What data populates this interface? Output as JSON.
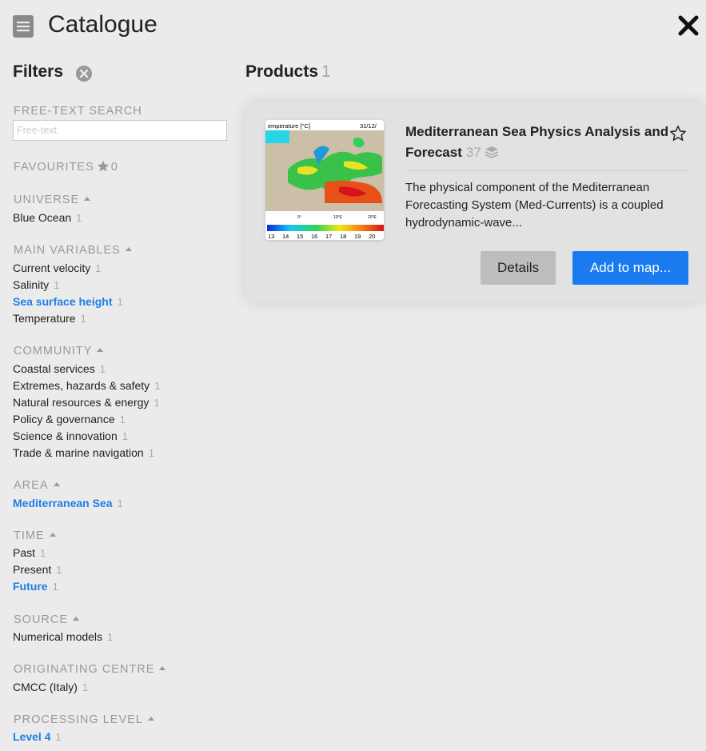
{
  "header": {
    "title": "Catalogue",
    "close_icon": "close-icon",
    "catalogue_icon": "catalogue-book-icon"
  },
  "filters": {
    "title": "Filters",
    "clear_icon": "clear-filters-icon",
    "search": {
      "label": "FREE-TEXT SEARCH",
      "placeholder": "Free-text",
      "value": ""
    },
    "favourites": {
      "label": "FAVOURITES",
      "count": "0",
      "icon": "star-icon"
    },
    "sections": [
      {
        "label": "UNIVERSE",
        "items": [
          {
            "label": "Blue Ocean",
            "count": "1",
            "active": false
          }
        ]
      },
      {
        "label": "MAIN VARIABLES",
        "items": [
          {
            "label": "Current velocity",
            "count": "1",
            "active": false
          },
          {
            "label": "Salinity",
            "count": "1",
            "active": false
          },
          {
            "label": "Sea surface height",
            "count": "1",
            "active": true
          },
          {
            "label": "Temperature",
            "count": "1",
            "active": false
          }
        ]
      },
      {
        "label": "COMMUNITY",
        "items": [
          {
            "label": "Coastal services",
            "count": "1",
            "active": false
          },
          {
            "label": "Extremes, hazards & safety",
            "count": "1",
            "active": false
          },
          {
            "label": "Natural resources & energy",
            "count": "1",
            "active": false
          },
          {
            "label": "Policy & governance",
            "count": "1",
            "active": false
          },
          {
            "label": "Science & innovation",
            "count": "1",
            "active": false
          },
          {
            "label": "Trade & marine navigation",
            "count": "1",
            "active": false
          }
        ]
      },
      {
        "label": "AREA",
        "items": [
          {
            "label": "Mediterranean Sea",
            "count": "1",
            "active": true
          }
        ]
      },
      {
        "label": "TIME",
        "items": [
          {
            "label": "Past",
            "count": "1",
            "active": false
          },
          {
            "label": "Present",
            "count": "1",
            "active": false
          },
          {
            "label": "Future",
            "count": "1",
            "active": true
          }
        ]
      },
      {
        "label": "SOURCE",
        "items": [
          {
            "label": "Numerical models",
            "count": "1",
            "active": false
          }
        ]
      },
      {
        "label": "ORIGINATING CENTRE",
        "items": [
          {
            "label": "CMCC (Italy)",
            "count": "1",
            "active": false
          }
        ]
      },
      {
        "label": "PROCESSING LEVEL",
        "items": [
          {
            "label": "Level 4",
            "count": "1",
            "active": true
          }
        ]
      }
    ]
  },
  "products": {
    "title": "Products",
    "count": "1",
    "items": [
      {
        "title": "Mediterranean Sea Physics Analysis and Forecast",
        "layers_count": "37",
        "description": "The physical component of the Mediterranean Forecasting System (Med-Currents) is a coupled hydrodynamic-wave...",
        "details_label": "Details",
        "add_label": "Add to map...",
        "thumbnail": {
          "header_left": "emperature [°C]",
          "header_right": "31/12/",
          "axis_ticks": [
            "0°",
            "10°E",
            "20°E"
          ],
          "scale_ticks": [
            "13",
            "14",
            "15",
            "16",
            "17",
            "18",
            "19",
            "20"
          ]
        },
        "favourite_icon": "star-outline-icon",
        "layers_icon": "layers-icon"
      }
    ]
  },
  "colors": {
    "background": "#ebebeb",
    "accent": "#1a7bf0",
    "active_filter": "#1f7ee6",
    "muted": "#999999",
    "card_background": "#e2e2e2"
  }
}
